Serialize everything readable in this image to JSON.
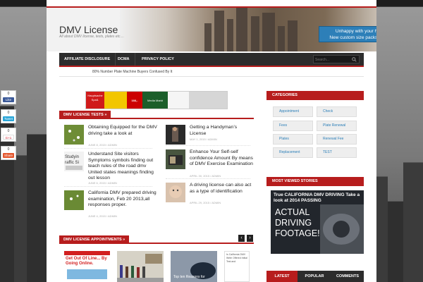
{
  "header": {
    "site_title": "DMV License",
    "site_description": "All about DMV license, tests, plates etc....",
    "promo_line1": "Unhappy with your hosting?",
    "promo_line2": "New custom size packs available."
  },
  "nav": {
    "items": [
      "AFFILIATE DISCLOSURE",
      "DCMA",
      "PRIVACY POLICY"
    ],
    "search_placeholder": "Search..."
  },
  "ticker": {
    "text": "80% Number Plate Machine Buyers Confused By It"
  },
  "social": [
    {
      "count": "0",
      "label": "Like"
    },
    {
      "count": "0",
      "label": "Tweet"
    },
    {
      "count": "0",
      "label": "G+1"
    },
    {
      "count": "0",
      "label": "Share"
    }
  ],
  "ad": {
    "text1": "Hauptsache Spaß.",
    "brand": "Media Markt",
    "price": "166,-"
  },
  "tests_section": {
    "label": "DMV LICENSE TESTS »",
    "left_posts": [
      {
        "title": "Obtaining Equipped for the DMV driving take a look at",
        "meta": "JUNE 8, 2015 / ADMIN"
      },
      {
        "title": "Understand Site visitors Symptoms symbols finding out teach rules of the road dmv United states meanings finding out lesson",
        "meta": "JUNE 6, 2015 / ADMIN"
      },
      {
        "title": "California DMV prepared driving examination, Feb 20 2013,all responses proper.",
        "meta": "JUNE 4, 2015 / ADMIN"
      }
    ],
    "right_posts": [
      {
        "title": "Getting a Handyman’s License",
        "meta": "MAY 1, 2015 / ADMIN"
      },
      {
        "title": "Enhance Your Self-self confidence Amount By means of DMV Exercise Examination",
        "meta": "APRIL 30, 2015 / ADMIN"
      },
      {
        "title": "A driving license can also act as a type of identification",
        "meta": "APRIL 29, 2015 / ADMIN"
      }
    ]
  },
  "appointments_section": {
    "label": "DMV LICENSE APPOINTMENTS »",
    "tile1_text": "Get Out Of Line... By Going Online.",
    "tile3_text": "Top ten Reasons for",
    "tile4_text": "Is California DMV Write Offered Initial Test and"
  },
  "sidebar": {
    "categories_label": "CATEGORIES",
    "categories": [
      "Appointment",
      "Check",
      "Fees",
      "Plate Renewal",
      "Plates",
      "Renewal Fee",
      "Replacement",
      "TEST"
    ],
    "most_viewed_label": "MOST VIEWED STORIES",
    "video_caption": "True CALIFORNIA DMV DRIVING Take a look at 2014 PASSING",
    "video_big_text": [
      "ACTUAL",
      "DRIVING",
      "FOOTAGE!"
    ],
    "tabs": [
      "LATEST",
      "POPULAR",
      "COMMENTS"
    ]
  },
  "colors": {
    "accent_red": "#b71d1d",
    "nav_dark": "#2c2c2c",
    "promo_blue": "#2d7fb8",
    "link_blue": "#2c7fb8"
  }
}
